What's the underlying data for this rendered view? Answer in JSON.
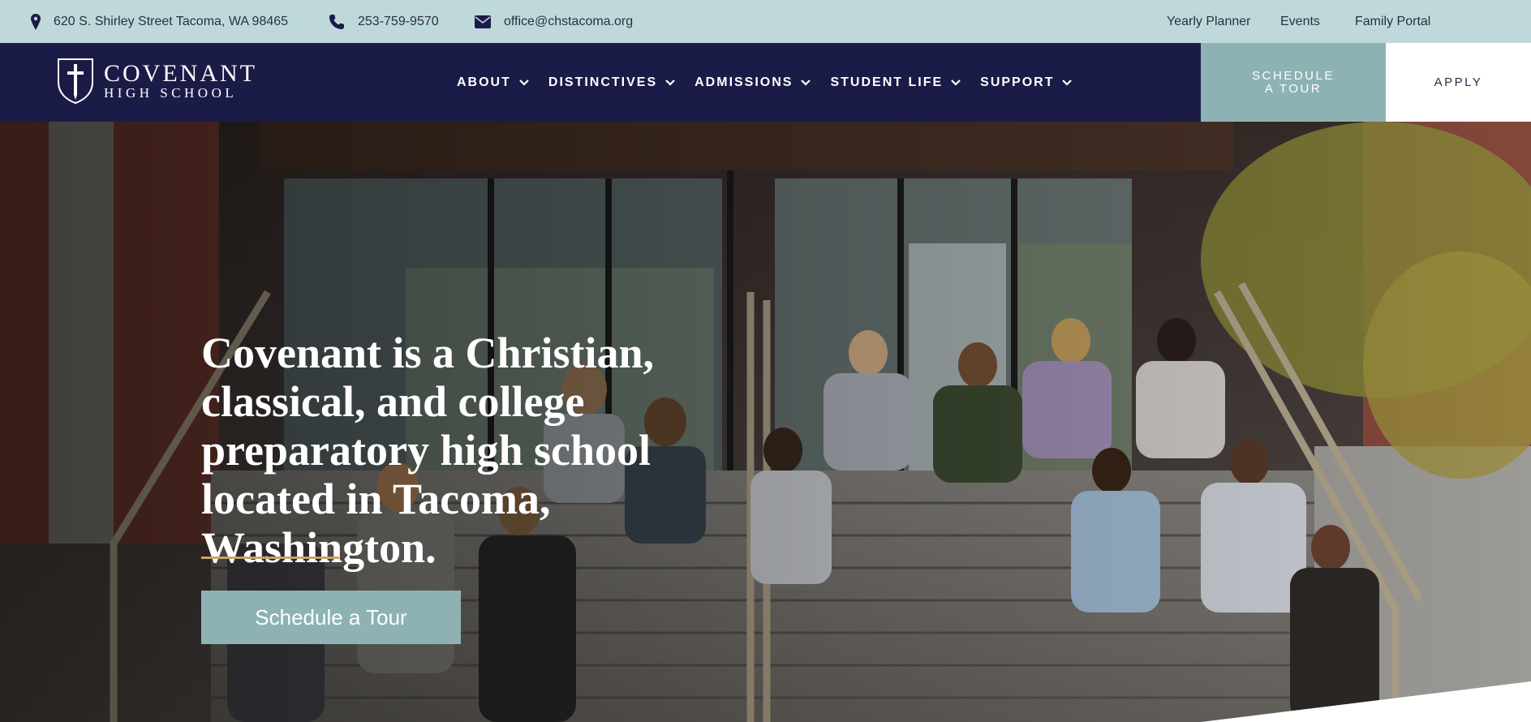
{
  "topbar": {
    "address": "620 S. Shirley Street Tacoma, WA 98465",
    "phone": "253-759-9570",
    "email": "office@chstacoma.org",
    "links": [
      "Yearly Planner",
      "Events",
      "Family Portal"
    ],
    "icons": [
      "map-pin-icon",
      "phone-icon",
      "envelope-icon"
    ]
  },
  "brand": {
    "name_line1": "Covenant",
    "name_line2": "High School"
  },
  "nav": {
    "items": [
      "ABOUT",
      "DISTINCTIVES",
      "ADMISSIONS",
      "STUDENT LIFE",
      "SUPPORT"
    ],
    "schedule_line1": "SCHEDULE",
    "schedule_line2": "A TOUR",
    "apply": "APPLY"
  },
  "hero": {
    "headline": "Covenant is a Christian, classical, and college preparatory high school located in Tacoma, Washington.",
    "cta": "Schedule a Tour"
  },
  "colors": {
    "topbar_bg": "#bfd9db",
    "nav_bg": "#1b1b47",
    "accent_teal": "#8eb2b3",
    "rule_gold": "#c9a36b"
  }
}
